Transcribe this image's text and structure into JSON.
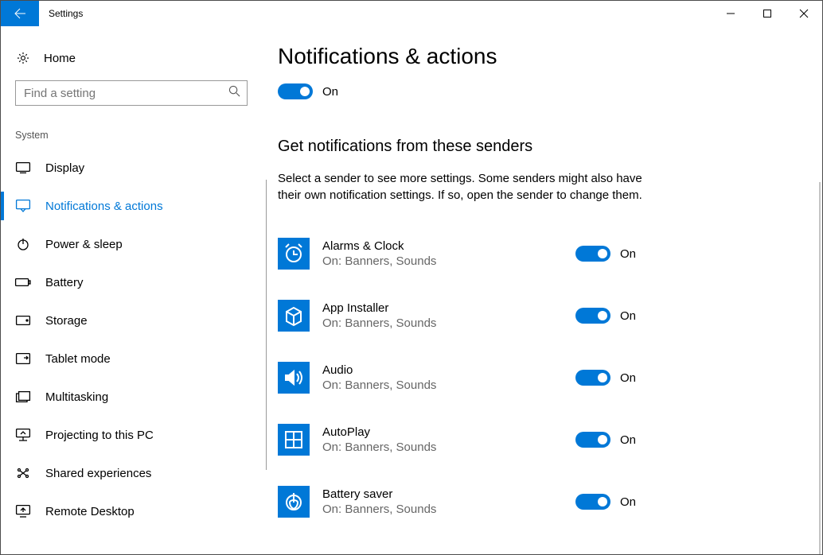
{
  "titlebar": {
    "title": "Settings"
  },
  "sidebar": {
    "home_label": "Home",
    "search_placeholder": "Find a setting",
    "category_label": "System",
    "items": [
      {
        "label": "Display"
      },
      {
        "label": "Notifications & actions",
        "active": true
      },
      {
        "label": "Power & sleep"
      },
      {
        "label": "Battery"
      },
      {
        "label": "Storage"
      },
      {
        "label": "Tablet mode"
      },
      {
        "label": "Multitasking"
      },
      {
        "label": "Projecting to this PC"
      },
      {
        "label": "Shared experiences"
      },
      {
        "label": "Remote Desktop"
      }
    ]
  },
  "content": {
    "page_title": "Notifications & actions",
    "master_toggle_label": "On",
    "section_title": "Get notifications from these senders",
    "section_desc": "Select a sender to see more settings. Some senders might also have their own notification settings. If so, open the sender to change them.",
    "senders": [
      {
        "name": "Alarms & Clock",
        "status": "On: Banners, Sounds",
        "toggle_label": "On"
      },
      {
        "name": "App Installer",
        "status": "On: Banners, Sounds",
        "toggle_label": "On"
      },
      {
        "name": "Audio",
        "status": "On: Banners, Sounds",
        "toggle_label": "On"
      },
      {
        "name": "AutoPlay",
        "status": "On: Banners, Sounds",
        "toggle_label": "On"
      },
      {
        "name": "Battery saver",
        "status": "On: Banners, Sounds",
        "toggle_label": "On"
      }
    ]
  }
}
